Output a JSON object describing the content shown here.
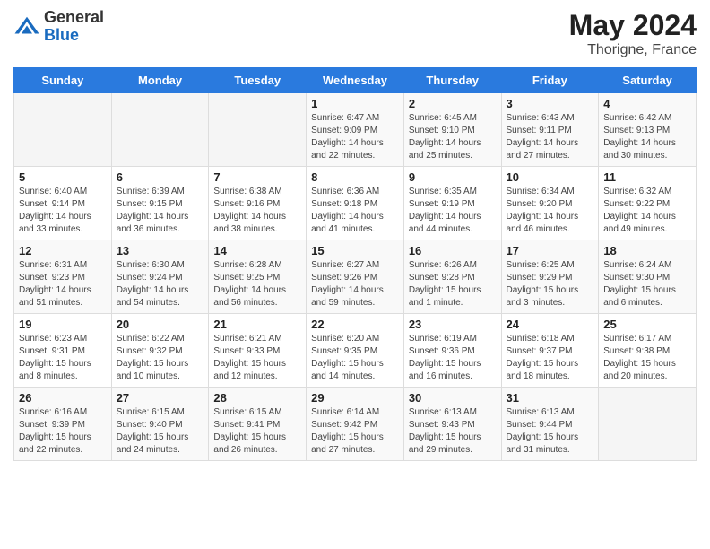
{
  "header": {
    "logo_general": "General",
    "logo_blue": "Blue",
    "month_year": "May 2024",
    "location": "Thorigne, France"
  },
  "weekdays": [
    "Sunday",
    "Monday",
    "Tuesday",
    "Wednesday",
    "Thursday",
    "Friday",
    "Saturday"
  ],
  "weeks": [
    [
      {
        "day": "",
        "info": ""
      },
      {
        "day": "",
        "info": ""
      },
      {
        "day": "",
        "info": ""
      },
      {
        "day": "1",
        "info": "Sunrise: 6:47 AM\nSunset: 9:09 PM\nDaylight: 14 hours\nand 22 minutes."
      },
      {
        "day": "2",
        "info": "Sunrise: 6:45 AM\nSunset: 9:10 PM\nDaylight: 14 hours\nand 25 minutes."
      },
      {
        "day": "3",
        "info": "Sunrise: 6:43 AM\nSunset: 9:11 PM\nDaylight: 14 hours\nand 27 minutes."
      },
      {
        "day": "4",
        "info": "Sunrise: 6:42 AM\nSunset: 9:13 PM\nDaylight: 14 hours\nand 30 minutes."
      }
    ],
    [
      {
        "day": "5",
        "info": "Sunrise: 6:40 AM\nSunset: 9:14 PM\nDaylight: 14 hours\nand 33 minutes."
      },
      {
        "day": "6",
        "info": "Sunrise: 6:39 AM\nSunset: 9:15 PM\nDaylight: 14 hours\nand 36 minutes."
      },
      {
        "day": "7",
        "info": "Sunrise: 6:38 AM\nSunset: 9:16 PM\nDaylight: 14 hours\nand 38 minutes."
      },
      {
        "day": "8",
        "info": "Sunrise: 6:36 AM\nSunset: 9:18 PM\nDaylight: 14 hours\nand 41 minutes."
      },
      {
        "day": "9",
        "info": "Sunrise: 6:35 AM\nSunset: 9:19 PM\nDaylight: 14 hours\nand 44 minutes."
      },
      {
        "day": "10",
        "info": "Sunrise: 6:34 AM\nSunset: 9:20 PM\nDaylight: 14 hours\nand 46 minutes."
      },
      {
        "day": "11",
        "info": "Sunrise: 6:32 AM\nSunset: 9:22 PM\nDaylight: 14 hours\nand 49 minutes."
      }
    ],
    [
      {
        "day": "12",
        "info": "Sunrise: 6:31 AM\nSunset: 9:23 PM\nDaylight: 14 hours\nand 51 minutes."
      },
      {
        "day": "13",
        "info": "Sunrise: 6:30 AM\nSunset: 9:24 PM\nDaylight: 14 hours\nand 54 minutes."
      },
      {
        "day": "14",
        "info": "Sunrise: 6:28 AM\nSunset: 9:25 PM\nDaylight: 14 hours\nand 56 minutes."
      },
      {
        "day": "15",
        "info": "Sunrise: 6:27 AM\nSunset: 9:26 PM\nDaylight: 14 hours\nand 59 minutes."
      },
      {
        "day": "16",
        "info": "Sunrise: 6:26 AM\nSunset: 9:28 PM\nDaylight: 15 hours\nand 1 minute."
      },
      {
        "day": "17",
        "info": "Sunrise: 6:25 AM\nSunset: 9:29 PM\nDaylight: 15 hours\nand 3 minutes."
      },
      {
        "day": "18",
        "info": "Sunrise: 6:24 AM\nSunset: 9:30 PM\nDaylight: 15 hours\nand 6 minutes."
      }
    ],
    [
      {
        "day": "19",
        "info": "Sunrise: 6:23 AM\nSunset: 9:31 PM\nDaylight: 15 hours\nand 8 minutes."
      },
      {
        "day": "20",
        "info": "Sunrise: 6:22 AM\nSunset: 9:32 PM\nDaylight: 15 hours\nand 10 minutes."
      },
      {
        "day": "21",
        "info": "Sunrise: 6:21 AM\nSunset: 9:33 PM\nDaylight: 15 hours\nand 12 minutes."
      },
      {
        "day": "22",
        "info": "Sunrise: 6:20 AM\nSunset: 9:35 PM\nDaylight: 15 hours\nand 14 minutes."
      },
      {
        "day": "23",
        "info": "Sunrise: 6:19 AM\nSunset: 9:36 PM\nDaylight: 15 hours\nand 16 minutes."
      },
      {
        "day": "24",
        "info": "Sunrise: 6:18 AM\nSunset: 9:37 PM\nDaylight: 15 hours\nand 18 minutes."
      },
      {
        "day": "25",
        "info": "Sunrise: 6:17 AM\nSunset: 9:38 PM\nDaylight: 15 hours\nand 20 minutes."
      }
    ],
    [
      {
        "day": "26",
        "info": "Sunrise: 6:16 AM\nSunset: 9:39 PM\nDaylight: 15 hours\nand 22 minutes."
      },
      {
        "day": "27",
        "info": "Sunrise: 6:15 AM\nSunset: 9:40 PM\nDaylight: 15 hours\nand 24 minutes."
      },
      {
        "day": "28",
        "info": "Sunrise: 6:15 AM\nSunset: 9:41 PM\nDaylight: 15 hours\nand 26 minutes."
      },
      {
        "day": "29",
        "info": "Sunrise: 6:14 AM\nSunset: 9:42 PM\nDaylight: 15 hours\nand 27 minutes."
      },
      {
        "day": "30",
        "info": "Sunrise: 6:13 AM\nSunset: 9:43 PM\nDaylight: 15 hours\nand 29 minutes."
      },
      {
        "day": "31",
        "info": "Sunrise: 6:13 AM\nSunset: 9:44 PM\nDaylight: 15 hours\nand 31 minutes."
      },
      {
        "day": "",
        "info": ""
      }
    ]
  ]
}
